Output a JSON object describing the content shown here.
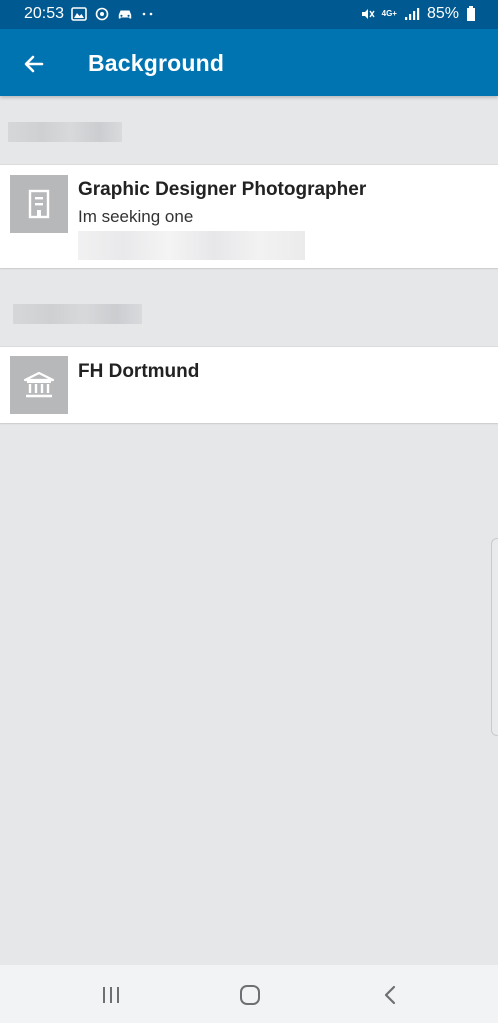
{
  "status_bar": {
    "time": "20:53",
    "battery": "85%",
    "network": "4G+",
    "icons_left": [
      "gallery-icon",
      "sync-icon",
      "car-icon",
      "more-dots-icon"
    ],
    "icons_right": [
      "mute-vibrate-icon",
      "network-4g-icon",
      "signal-icon",
      "battery-icon"
    ]
  },
  "app_bar": {
    "title": "Background",
    "color": "#0073b1",
    "status_color": "#005a91"
  },
  "sections": [
    {
      "header": "",
      "items": [
        {
          "title": "Graphic Designer Photographer",
          "subtitle": "Im seeking one",
          "icon": "building-icon"
        }
      ]
    },
    {
      "header": "",
      "items": [
        {
          "title": "FH Dortmund",
          "icon": "institution-icon"
        }
      ]
    }
  ],
  "nav_bar": {
    "buttons": [
      "recents-icon",
      "home-icon",
      "back-nav-icon"
    ]
  }
}
